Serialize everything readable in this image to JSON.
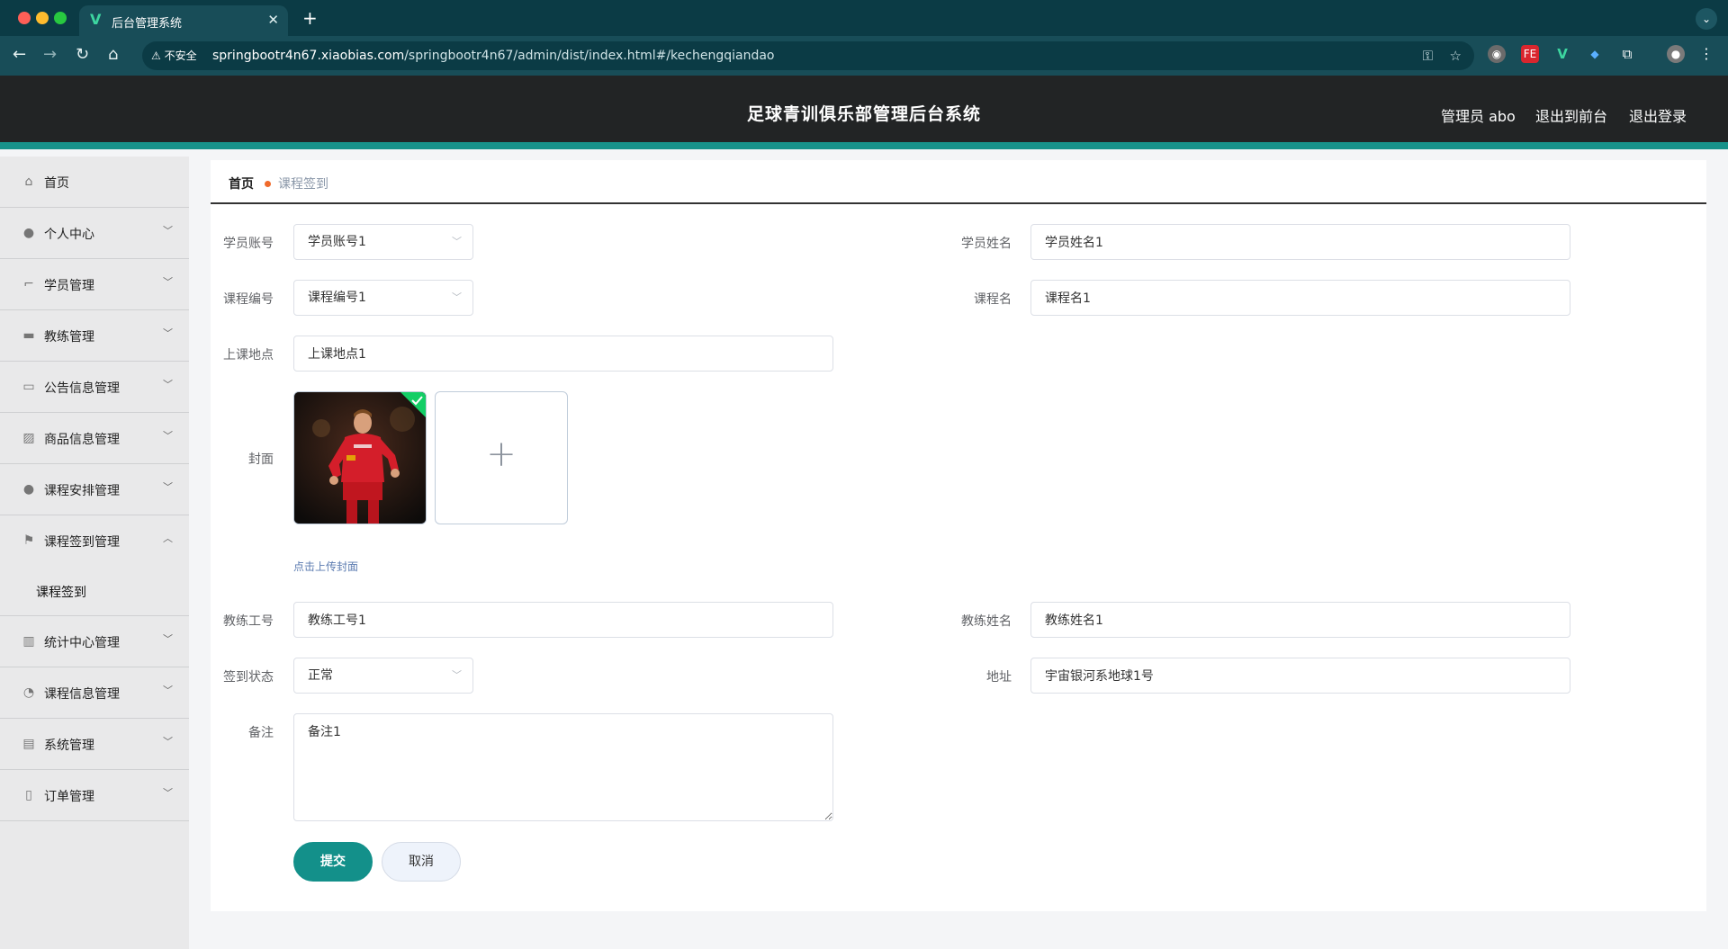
{
  "browser": {
    "tab_title": "后台管理系统",
    "insecure_label": "不安全",
    "url_host": "springbootr4n67.xiaobias.com",
    "url_path": "/springbootr4n67/admin/dist/index.html#/kechengqiandao"
  },
  "header": {
    "title": "足球青训俱乐部管理后台系统",
    "user_label": "管理员 abo",
    "front_link": "退出到前台",
    "logout_link": "退出登录"
  },
  "sidebar": {
    "items": [
      {
        "label": "首页"
      },
      {
        "label": "个人中心"
      },
      {
        "label": "学员管理"
      },
      {
        "label": "教练管理"
      },
      {
        "label": "公告信息管理"
      },
      {
        "label": "商品信息管理"
      },
      {
        "label": "课程安排管理"
      },
      {
        "label": "课程签到管理"
      },
      {
        "label": "统计中心管理"
      },
      {
        "label": "课程信息管理"
      },
      {
        "label": "系统管理"
      },
      {
        "label": "订单管理"
      }
    ],
    "submenu_label": "课程签到"
  },
  "breadcrumb": {
    "home": "首页",
    "current": "课程签到"
  },
  "form": {
    "student_account": {
      "label": "学员账号",
      "value": "学员账号1"
    },
    "student_name": {
      "label": "学员姓名",
      "value": "学员姓名1"
    },
    "course_no": {
      "label": "课程编号",
      "value": "课程编号1"
    },
    "course_name": {
      "label": "课程名",
      "value": "课程名1"
    },
    "location": {
      "label": "上课地点",
      "value": "上课地点1"
    },
    "cover": {
      "label": "封面",
      "tip": "点击上传封面"
    },
    "coach_id": {
      "label": "教练工号",
      "value": "教练工号1"
    },
    "coach_name": {
      "label": "教练姓名",
      "value": "教练姓名1"
    },
    "checkin_status": {
      "label": "签到状态",
      "value": "正常"
    },
    "address": {
      "label": "地址",
      "value": "宇宙银河系地球1号"
    },
    "remark": {
      "label": "备注",
      "value": "备注1"
    },
    "submit_label": "提交",
    "cancel_label": "取消"
  },
  "colors": {
    "accent": "#13908a",
    "header_bg": "#222425"
  }
}
